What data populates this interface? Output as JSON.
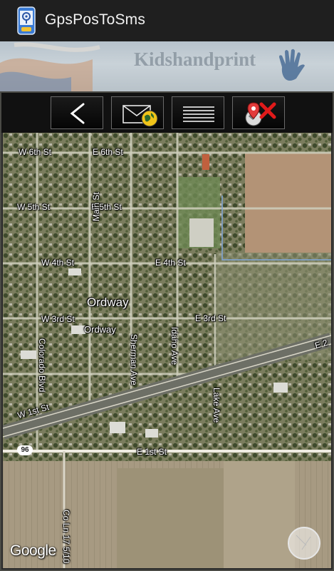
{
  "app": {
    "title": "GpsPosToSms",
    "icon": "gps-phone-app-icon"
  },
  "banner": {
    "text": "Kidshandprint",
    "icon": "handprint-icon"
  },
  "toolbar": {
    "buttons": [
      {
        "name": "back",
        "icon": "chevron-left-icon"
      },
      {
        "name": "send-sms",
        "icon": "envelope-globe-icon"
      },
      {
        "name": "menu",
        "icon": "menu-lines-icon"
      },
      {
        "name": "delete-position",
        "icon": "location-pin-delete-icon"
      }
    ]
  },
  "map": {
    "type": "satellite",
    "streets": {
      "w6": "W 6th St",
      "e6": "E 6th St",
      "w5": "W 5th St",
      "e5": "E 5th St",
      "w4": "W 4th St",
      "e4": "E 4th St",
      "w3": "W 3rd St",
      "e3": "E 3rd St",
      "e2": "E 2",
      "w1": "W 1st St",
      "e1": "E 1st St",
      "main": "Main St",
      "colorado": "Colorado Blvd",
      "sherman": "Sherman Ave",
      "idaho": "Idaho Ave",
      "lake": "Lake Ave",
      "cr": "Co Ln 17 5/10"
    },
    "town": "Ordway",
    "town_small": "Ordway",
    "route_shield": "96",
    "attribution": "Google",
    "compass_icon": "compass-icon"
  },
  "colors": {
    "appbar": "#1f1f1f",
    "toolbar": "#111111",
    "button_border": "#6a6a6a",
    "delete_red": "#e01a1a"
  }
}
